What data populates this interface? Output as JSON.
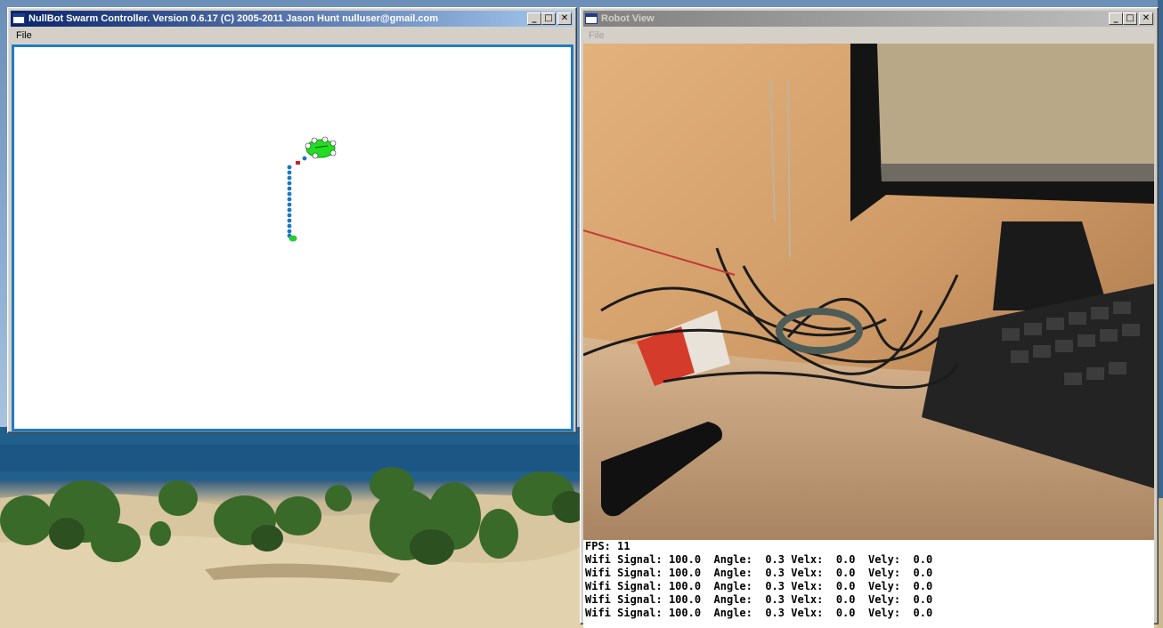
{
  "controller": {
    "title": "NullBot Swarm Controller. Version 0.6.17 (C) 2005-2011 Jason Hunt nulluser@gmail.com",
    "menu": [
      "File"
    ]
  },
  "robot_view": {
    "title": "Robot View",
    "menu": [
      "File"
    ],
    "fps_label": "FPS:",
    "fps_value": "11",
    "rows": [
      {
        "wifi_label": "Wifi Signal:",
        "wifi": "100.0",
        "angle_label": "Angle:",
        "angle": "0.3",
        "velx_label": "Velx:",
        "velx": "0.0",
        "vely_label": "Vely:",
        "vely": "0.0"
      },
      {
        "wifi_label": "Wifi Signal:",
        "wifi": "100.0",
        "angle_label": "Angle:",
        "angle": "0.3",
        "velx_label": "Velx:",
        "velx": "0.0",
        "vely_label": "Vely:",
        "vely": "0.0"
      },
      {
        "wifi_label": "Wifi Signal:",
        "wifi": "100.0",
        "angle_label": "Angle:",
        "angle": "0.3",
        "velx_label": "Velx:",
        "velx": "0.0",
        "vely_label": "Vely:",
        "vely": "0.0"
      },
      {
        "wifi_label": "Wifi Signal:",
        "wifi": "100.0",
        "angle_label": "Angle:",
        "angle": "0.3",
        "velx_label": "Velx:",
        "velx": "0.0",
        "vely_label": "Vely:",
        "vely": "0.0"
      },
      {
        "wifi_label": "Wifi Signal:",
        "wifi": "100.0",
        "angle_label": "Angle:",
        "angle": "0.3",
        "velx_label": "Velx:",
        "velx": "0.0",
        "vely_label": "Vely:",
        "vely": "0.0"
      }
    ]
  },
  "window_buttons": {
    "minimize": "_",
    "maximize": "□",
    "close": "✕"
  },
  "colors": {
    "active_title": "#0a246a",
    "canvas_border": "#1e7bc6",
    "robot_green": "#22dd22",
    "trail_blue": "#1b75c2"
  }
}
